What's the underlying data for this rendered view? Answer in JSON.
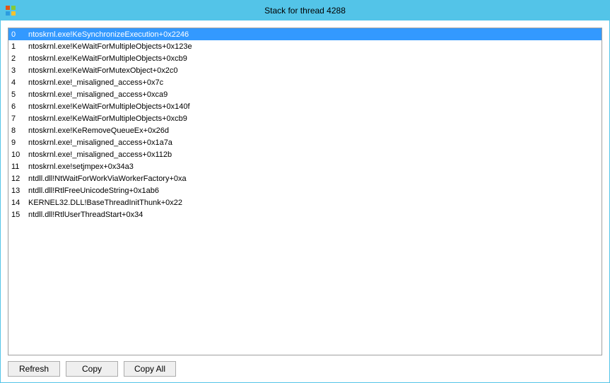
{
  "window": {
    "title": "Stack for thread 4288"
  },
  "stack": {
    "selected_index": 0,
    "frames": [
      {
        "idx": "0",
        "sym": "ntoskrnl.exe!KeSynchronizeExecution+0x2246"
      },
      {
        "idx": "1",
        "sym": "ntoskrnl.exe!KeWaitForMultipleObjects+0x123e"
      },
      {
        "idx": "2",
        "sym": "ntoskrnl.exe!KeWaitForMultipleObjects+0xcb9"
      },
      {
        "idx": "3",
        "sym": "ntoskrnl.exe!KeWaitForMutexObject+0x2c0"
      },
      {
        "idx": "4",
        "sym": "ntoskrnl.exe!_misaligned_access+0x7c"
      },
      {
        "idx": "5",
        "sym": "ntoskrnl.exe!_misaligned_access+0xca9"
      },
      {
        "idx": "6",
        "sym": "ntoskrnl.exe!KeWaitForMultipleObjects+0x140f"
      },
      {
        "idx": "7",
        "sym": "ntoskrnl.exe!KeWaitForMultipleObjects+0xcb9"
      },
      {
        "idx": "8",
        "sym": "ntoskrnl.exe!KeRemoveQueueEx+0x26d"
      },
      {
        "idx": "9",
        "sym": "ntoskrnl.exe!_misaligned_access+0x1a7a"
      },
      {
        "idx": "10",
        "sym": "ntoskrnl.exe!_misaligned_access+0x112b"
      },
      {
        "idx": "11",
        "sym": "ntoskrnl.exe!setjmpex+0x34a3"
      },
      {
        "idx": "12",
        "sym": "ntdll.dll!NtWaitForWorkViaWorkerFactory+0xa"
      },
      {
        "idx": "13",
        "sym": "ntdll.dll!RtlFreeUnicodeString+0x1ab6"
      },
      {
        "idx": "14",
        "sym": "KERNEL32.DLL!BaseThreadInitThunk+0x22"
      },
      {
        "idx": "15",
        "sym": "ntdll.dll!RtlUserThreadStart+0x34"
      }
    ]
  },
  "buttons": {
    "refresh": "Refresh",
    "copy": "Copy",
    "copy_all": "Copy All"
  }
}
